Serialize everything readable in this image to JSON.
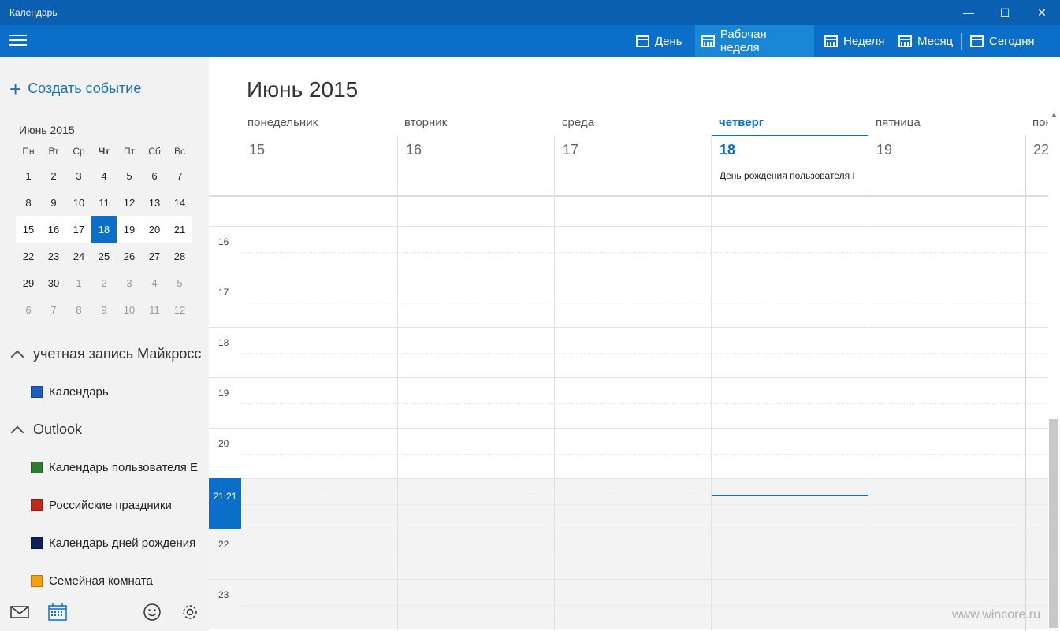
{
  "window": {
    "title": "Календарь",
    "minimize": "—",
    "maximize": "☐",
    "close": "✕"
  },
  "toolbar": {
    "views": [
      {
        "label": "День",
        "icon": "calendar-day-icon"
      },
      {
        "label": "Рабочая неделя",
        "icon": "calendar-workweek-icon",
        "active": true
      },
      {
        "label": "Неделя",
        "icon": "calendar-week-icon"
      },
      {
        "label": "Месяц",
        "icon": "calendar-month-icon"
      },
      {
        "label": "Сегодня",
        "icon": "calendar-today-icon"
      }
    ]
  },
  "sidebar": {
    "new_event": "Создать событие",
    "mini_calendar": {
      "title": "Июнь 2015",
      "weekdays": [
        "Пн",
        "Вт",
        "Ср",
        "Чт",
        "Пт",
        "Сб",
        "Вс"
      ],
      "weeks": [
        [
          "1",
          "2",
          "3",
          "4",
          "5",
          "6",
          "7"
        ],
        [
          "8",
          "9",
          "10",
          "11",
          "12",
          "13",
          "14"
        ],
        [
          "15",
          "16",
          "17",
          "18",
          "19",
          "20",
          "21"
        ],
        [
          "22",
          "23",
          "24",
          "25",
          "26",
          "27",
          "28"
        ],
        [
          "29",
          "30",
          "1",
          "2",
          "3",
          "4",
          "5"
        ],
        [
          "6",
          "7",
          "8",
          "9",
          "10",
          "11",
          "12"
        ]
      ],
      "today": "18"
    },
    "accounts": [
      {
        "name": "учетная запись Майкросс",
        "calendars": [
          {
            "name": "Календарь",
            "color": "#1b5fc0"
          }
        ]
      },
      {
        "name": "Outlook",
        "calendars": [
          {
            "name": "Календарь пользователя Е",
            "color": "#2e7d32"
          },
          {
            "name": "Российские праздники",
            "color": "#c0281a"
          },
          {
            "name": "Календарь дней рождения",
            "color": "#0d1f5c"
          },
          {
            "name": "Семейная комната",
            "color": "#f5a20a"
          }
        ]
      }
    ]
  },
  "main": {
    "month_title": "Июнь 2015",
    "days": [
      {
        "name": "понедельник",
        "date": "15"
      },
      {
        "name": "вторник",
        "date": "16"
      },
      {
        "name": "среда",
        "date": "17"
      },
      {
        "name": "четверг",
        "date": "18",
        "today": true,
        "event": "День рождения пользователя I"
      },
      {
        "name": "пятница",
        "date": "19"
      },
      {
        "name": "пон",
        "date": "22"
      }
    ],
    "hours": [
      "16",
      "17",
      "18",
      "19",
      "20",
      "21",
      "22",
      "23"
    ],
    "current_time": "21:21"
  },
  "watermark": "www.wincore.ru"
}
